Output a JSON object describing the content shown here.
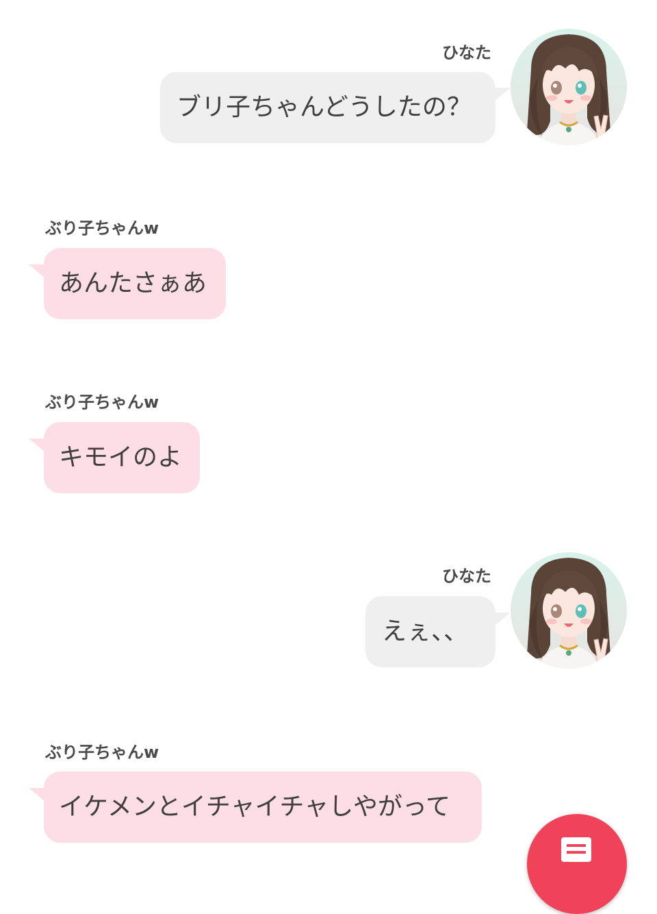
{
  "messages": [
    {
      "side": "right",
      "sender": "ひなた",
      "text": "ブリ子ちゃんどうしたの？"
    },
    {
      "side": "left",
      "sender": "ぶり子ちゃんw",
      "text": "あんたさぁあ"
    },
    {
      "side": "left",
      "sender": "ぶり子ちゃんw",
      "text": "キモイのよ"
    },
    {
      "side": "right",
      "sender": "ひなた",
      "text": "えぇ、、"
    },
    {
      "side": "left",
      "sender": "ぶり子ちゃんw",
      "text": "イケメンとイチャイチャしやがって"
    }
  ],
  "colors": {
    "left_bubble": "#fddde6",
    "right_bubble": "#efefef",
    "fab": "#f0435a"
  },
  "icons": {
    "avatar": "girl-avatar",
    "fab": "memo-icon"
  }
}
